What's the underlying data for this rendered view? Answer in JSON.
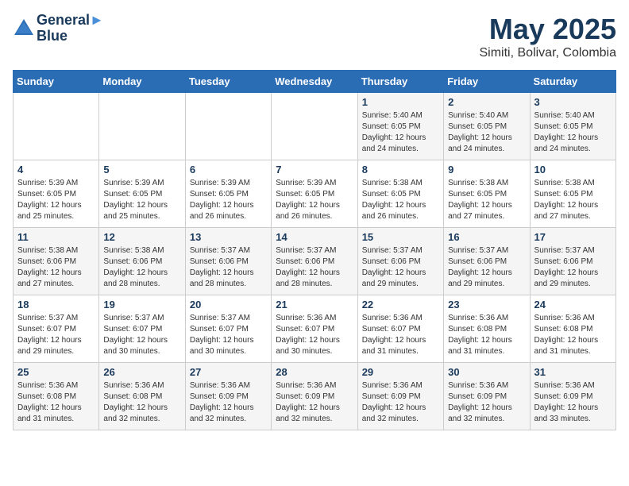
{
  "header": {
    "logo_line1": "General",
    "logo_line2": "Blue",
    "title": "May 2025",
    "subtitle": "Simiti, Bolivar, Colombia"
  },
  "weekdays": [
    "Sunday",
    "Monday",
    "Tuesday",
    "Wednesday",
    "Thursday",
    "Friday",
    "Saturday"
  ],
  "weeks": [
    [
      {
        "day": "",
        "info": ""
      },
      {
        "day": "",
        "info": ""
      },
      {
        "day": "",
        "info": ""
      },
      {
        "day": "",
        "info": ""
      },
      {
        "day": "1",
        "info": "Sunrise: 5:40 AM\nSunset: 6:05 PM\nDaylight: 12 hours\nand 24 minutes."
      },
      {
        "day": "2",
        "info": "Sunrise: 5:40 AM\nSunset: 6:05 PM\nDaylight: 12 hours\nand 24 minutes."
      },
      {
        "day": "3",
        "info": "Sunrise: 5:40 AM\nSunset: 6:05 PM\nDaylight: 12 hours\nand 24 minutes."
      }
    ],
    [
      {
        "day": "4",
        "info": "Sunrise: 5:39 AM\nSunset: 6:05 PM\nDaylight: 12 hours\nand 25 minutes."
      },
      {
        "day": "5",
        "info": "Sunrise: 5:39 AM\nSunset: 6:05 PM\nDaylight: 12 hours\nand 25 minutes."
      },
      {
        "day": "6",
        "info": "Sunrise: 5:39 AM\nSunset: 6:05 PM\nDaylight: 12 hours\nand 26 minutes."
      },
      {
        "day": "7",
        "info": "Sunrise: 5:39 AM\nSunset: 6:05 PM\nDaylight: 12 hours\nand 26 minutes."
      },
      {
        "day": "8",
        "info": "Sunrise: 5:38 AM\nSunset: 6:05 PM\nDaylight: 12 hours\nand 26 minutes."
      },
      {
        "day": "9",
        "info": "Sunrise: 5:38 AM\nSunset: 6:05 PM\nDaylight: 12 hours\nand 27 minutes."
      },
      {
        "day": "10",
        "info": "Sunrise: 5:38 AM\nSunset: 6:05 PM\nDaylight: 12 hours\nand 27 minutes."
      }
    ],
    [
      {
        "day": "11",
        "info": "Sunrise: 5:38 AM\nSunset: 6:06 PM\nDaylight: 12 hours\nand 27 minutes."
      },
      {
        "day": "12",
        "info": "Sunrise: 5:38 AM\nSunset: 6:06 PM\nDaylight: 12 hours\nand 28 minutes."
      },
      {
        "day": "13",
        "info": "Sunrise: 5:37 AM\nSunset: 6:06 PM\nDaylight: 12 hours\nand 28 minutes."
      },
      {
        "day": "14",
        "info": "Sunrise: 5:37 AM\nSunset: 6:06 PM\nDaylight: 12 hours\nand 28 minutes."
      },
      {
        "day": "15",
        "info": "Sunrise: 5:37 AM\nSunset: 6:06 PM\nDaylight: 12 hours\nand 29 minutes."
      },
      {
        "day": "16",
        "info": "Sunrise: 5:37 AM\nSunset: 6:06 PM\nDaylight: 12 hours\nand 29 minutes."
      },
      {
        "day": "17",
        "info": "Sunrise: 5:37 AM\nSunset: 6:06 PM\nDaylight: 12 hours\nand 29 minutes."
      }
    ],
    [
      {
        "day": "18",
        "info": "Sunrise: 5:37 AM\nSunset: 6:07 PM\nDaylight: 12 hours\nand 29 minutes."
      },
      {
        "day": "19",
        "info": "Sunrise: 5:37 AM\nSunset: 6:07 PM\nDaylight: 12 hours\nand 30 minutes."
      },
      {
        "day": "20",
        "info": "Sunrise: 5:37 AM\nSunset: 6:07 PM\nDaylight: 12 hours\nand 30 minutes."
      },
      {
        "day": "21",
        "info": "Sunrise: 5:36 AM\nSunset: 6:07 PM\nDaylight: 12 hours\nand 30 minutes."
      },
      {
        "day": "22",
        "info": "Sunrise: 5:36 AM\nSunset: 6:07 PM\nDaylight: 12 hours\nand 31 minutes."
      },
      {
        "day": "23",
        "info": "Sunrise: 5:36 AM\nSunset: 6:08 PM\nDaylight: 12 hours\nand 31 minutes."
      },
      {
        "day": "24",
        "info": "Sunrise: 5:36 AM\nSunset: 6:08 PM\nDaylight: 12 hours\nand 31 minutes."
      }
    ],
    [
      {
        "day": "25",
        "info": "Sunrise: 5:36 AM\nSunset: 6:08 PM\nDaylight: 12 hours\nand 31 minutes."
      },
      {
        "day": "26",
        "info": "Sunrise: 5:36 AM\nSunset: 6:08 PM\nDaylight: 12 hours\nand 32 minutes."
      },
      {
        "day": "27",
        "info": "Sunrise: 5:36 AM\nSunset: 6:09 PM\nDaylight: 12 hours\nand 32 minutes."
      },
      {
        "day": "28",
        "info": "Sunrise: 5:36 AM\nSunset: 6:09 PM\nDaylight: 12 hours\nand 32 minutes."
      },
      {
        "day": "29",
        "info": "Sunrise: 5:36 AM\nSunset: 6:09 PM\nDaylight: 12 hours\nand 32 minutes."
      },
      {
        "day": "30",
        "info": "Sunrise: 5:36 AM\nSunset: 6:09 PM\nDaylight: 12 hours\nand 32 minutes."
      },
      {
        "day": "31",
        "info": "Sunrise: 5:36 AM\nSunset: 6:09 PM\nDaylight: 12 hours\nand 33 minutes."
      }
    ]
  ]
}
